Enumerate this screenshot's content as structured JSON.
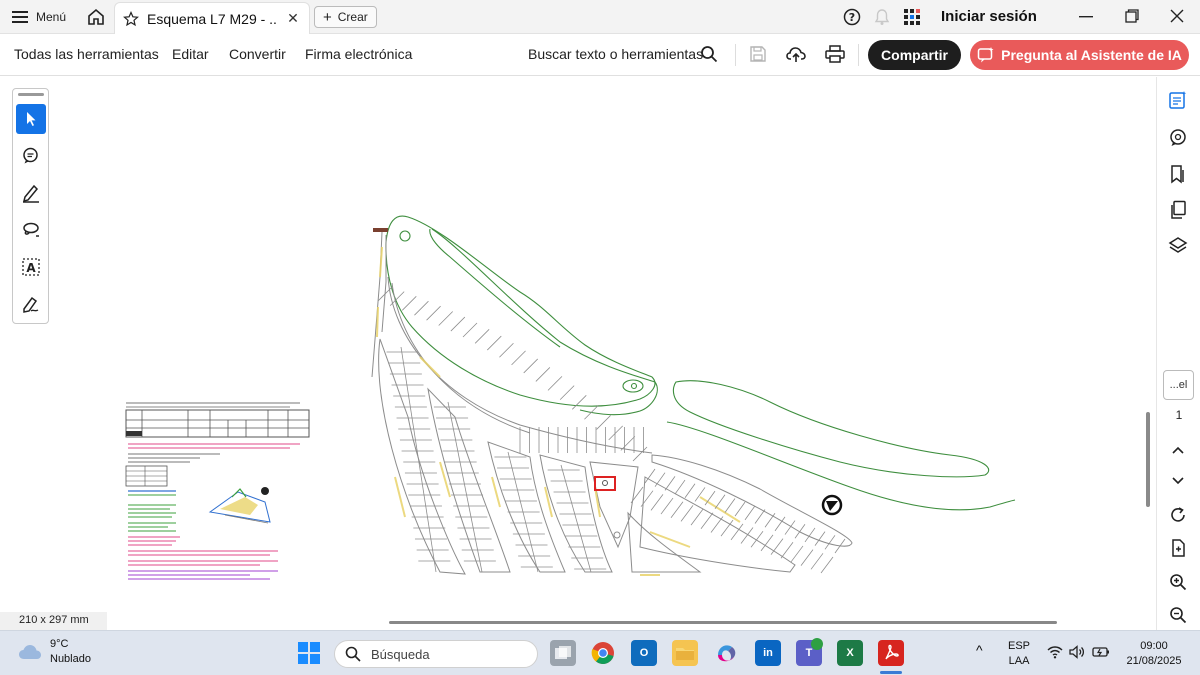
{
  "titlebar": {
    "menu_label": "Menú",
    "tab_title": "Esquema L7 M29 - ...",
    "new_tab_label": "Crear",
    "signin_label": "Iniciar sesión"
  },
  "toolbar": {
    "all_tools": "Todas las herramientas",
    "edit": "Editar",
    "convert": "Convertir",
    "esign": "Firma electrónica",
    "search_label": "Buscar texto o herramientas",
    "share_label": "Compartir",
    "ai_label": "Pregunta al Asistente de IA"
  },
  "document": {
    "page_size": "210 x 297 mm"
  },
  "right_rail": {
    "page_box": "...el",
    "page_number": "1"
  },
  "taskbar": {
    "temperature": "9°C",
    "condition": "Nublado",
    "search_placeholder": "Búsqueda",
    "lang_top": "ESP",
    "lang_bottom": "LAA",
    "time": "09:00",
    "date": "21/08/2025"
  },
  "colors": {
    "accent": "#1473e6",
    "ai_button": "#e95a5a",
    "share_button": "#1e1e1e",
    "plan_green": "#3e8e3e",
    "plan_grey": "#8c8c8c",
    "plan_yellow": "#e9d36a"
  }
}
